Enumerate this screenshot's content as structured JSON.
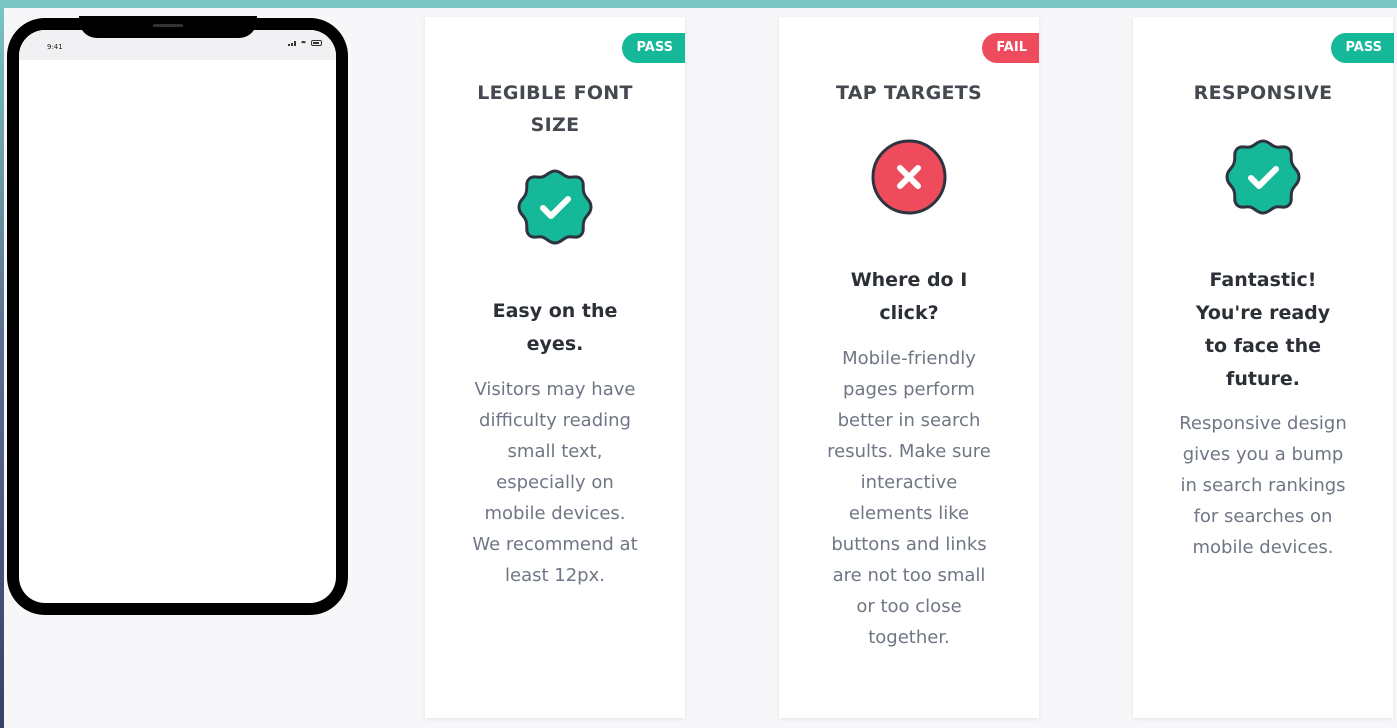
{
  "phone": {
    "time": "9:41"
  },
  "cards": [
    {
      "badge": "PASS",
      "status": "pass",
      "title": "LEGIBLE FONT SIZE",
      "heading": "Easy on the eyes.",
      "description": "Visitors may have difficulty reading small text, especially on mobile devices. We recommend at least 12px.",
      "icon": "check-badge-icon"
    },
    {
      "badge": "FAIL",
      "status": "fail",
      "title": "TAP TARGETS",
      "heading": "Where do I click?",
      "description": "Mobile-friendly pages perform better in search results. Make sure interactive elements like buttons and links are not too small or too close together.",
      "icon": "x-circle-icon"
    },
    {
      "badge": "PASS",
      "status": "pass",
      "title": "RESPONSIVE",
      "heading": "Fantastic! You're ready to face the future.",
      "description": "Responsive design gives you a bump in search rankings for searches on mobile devices.",
      "icon": "check-badge-icon"
    }
  ],
  "colors": {
    "pass": "#16b89a",
    "fail": "#ee4c5d",
    "outline": "#2d3440",
    "top_strip": "#79c5c2"
  }
}
